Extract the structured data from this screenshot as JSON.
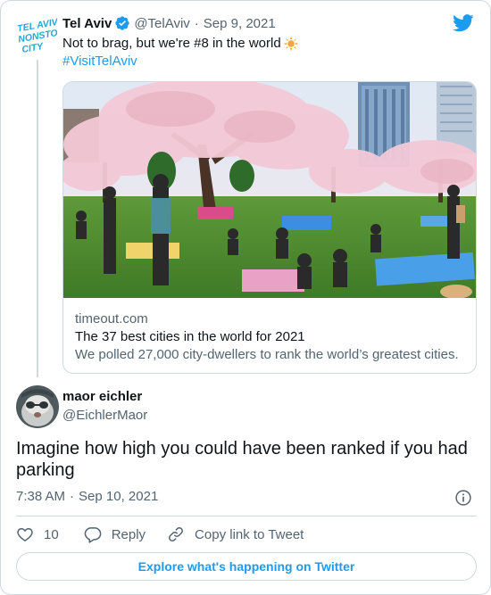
{
  "parent_tweet": {
    "display_name": "Tel Aviv",
    "handle": "@TelAviv",
    "date": "Sep 9, 2021",
    "avatar_logo_lines": [
      "TEL AVIV",
      "NONSTOP",
      "CITY"
    ],
    "text_line1": "Not to brag, but we're #8 in the world",
    "hashtag": "#VisitTelAviv",
    "link_card": {
      "domain": "timeout.com",
      "title": "The 37 best cities in the world for 2021",
      "description": "We polled 27,000 city-dwellers to rank the world’s greatest cities."
    }
  },
  "reply_tweet": {
    "display_name": "maor eichler",
    "handle": "@EichlerMaor",
    "text_line1": "Imagine how high you could have been ranked if you had",
    "text_line2": "parking",
    "time": "7:38 AM",
    "date": "Sep 10, 2021"
  },
  "actions": {
    "like_count": "10",
    "reply_label": "Reply",
    "copy_label": "Copy link to Tweet"
  },
  "explore_label": "Explore what's happening on Twitter",
  "icons": {
    "verified": "verified-badge-icon",
    "brand": "twitter-bird-icon",
    "emoji": "sun-emoji-icon",
    "info": "info-icon",
    "like": "heart-icon",
    "reply": "reply-bubble-icon",
    "copy": "link-icon"
  },
  "colors": {
    "accent": "#1d9bf0",
    "text": "#0f1419",
    "secondary": "#536471",
    "border": "#cfd9de",
    "logo": "#22a7d6"
  }
}
